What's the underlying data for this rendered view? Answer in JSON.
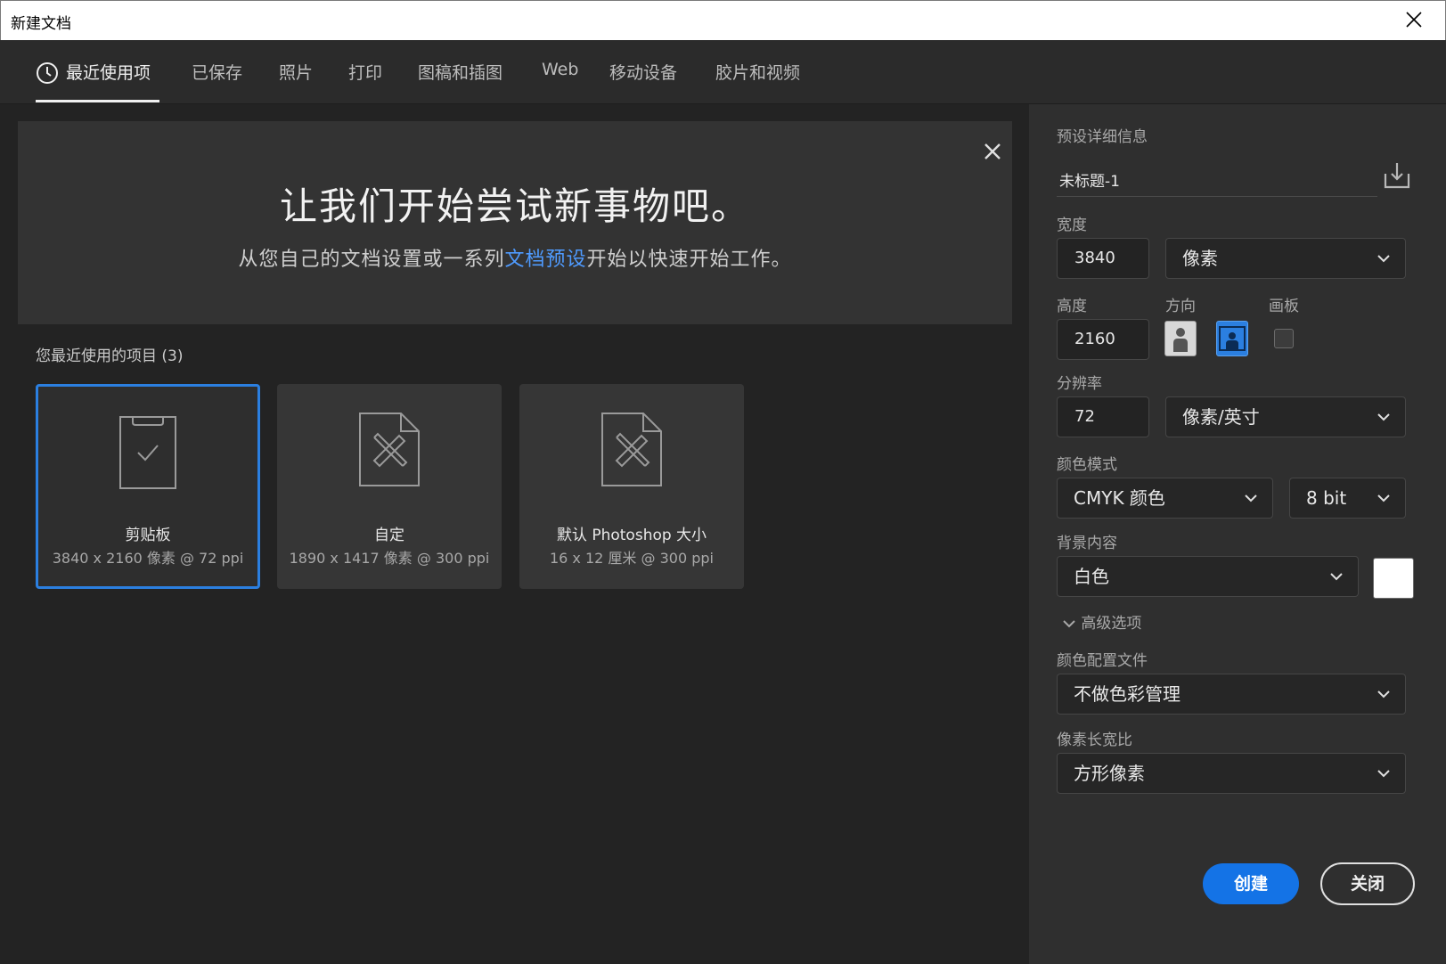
{
  "window": {
    "title": "新建文档"
  },
  "tabs": [
    {
      "label": "最近使用项"
    },
    {
      "label": "已保存"
    },
    {
      "label": "照片"
    },
    {
      "label": "打印"
    },
    {
      "label": "图稿和插图"
    },
    {
      "label": "Web"
    },
    {
      "label": "移动设备"
    },
    {
      "label": "胶片和视频"
    }
  ],
  "welcome": {
    "heading": "让我们开始尝试新事物吧。",
    "text_before": "从您自己的文档设置或一系列",
    "link": "文档预设",
    "text_after": "开始以快速开始工作。"
  },
  "recent": {
    "label": "您最近使用的项目 (3)",
    "items": [
      {
        "name": "剪贴板",
        "desc": "3840 x 2160 像素 @ 72 ppi"
      },
      {
        "name": "自定",
        "desc": "1890 x 1417 像素 @ 300 ppi"
      },
      {
        "name": "默认 Photoshop 大小",
        "desc": "16 x 12 厘米 @ 300 ppi"
      }
    ]
  },
  "preset": {
    "section_label": "预设详细信息",
    "name": "未标题-1",
    "width_label": "宽度",
    "width": "3840",
    "width_unit": "像素",
    "height_label": "高度",
    "height": "2160",
    "orientation_label": "方向",
    "artboard_label": "画板",
    "resolution_label": "分辨率",
    "resolution": "72",
    "resolution_unit": "像素/英寸",
    "color_mode_label": "颜色模式",
    "color_mode": "CMYK 颜色",
    "bit_depth": "8 bit",
    "background_label": "背景内容",
    "background": "白色",
    "advanced_label": "高级选项",
    "color_profile_label": "颜色配置文件",
    "color_profile": "不做色彩管理",
    "pixel_aspect_label": "像素长宽比",
    "pixel_aspect": "方形像素",
    "create_label": "创建",
    "close_label": "关闭"
  },
  "colors": {
    "accent": "#1473e6",
    "selected_border": "#2b7fe0",
    "link": "#4f9bff",
    "background_swatch": "#ffffff"
  },
  "icons": {
    "window_close": "close-icon",
    "recent_tab": "clock-icon",
    "welcome_close": "close-icon",
    "clipboard": "clipboard-check-icon",
    "custom": "document-ruler-icon",
    "default": "document-ruler-icon",
    "save_preset": "save-preset-icon",
    "portrait": "portrait-orientation-icon",
    "landscape": "landscape-orientation-icon"
  }
}
